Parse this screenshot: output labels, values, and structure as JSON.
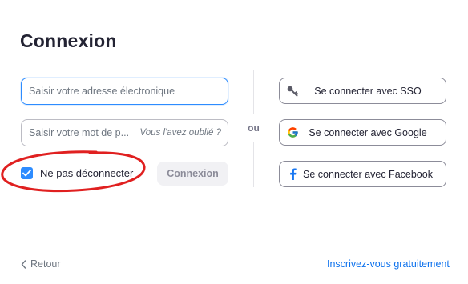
{
  "header": {
    "title": "Connexion"
  },
  "form": {
    "email_placeholder": "Saisir votre adresse électronique",
    "password_placeholder": "Saisir votre mot de p...",
    "forgot_link": "Vous l'avez oublié ?",
    "keep_signed_in_label": "Ne pas déconnecter",
    "keep_signed_in_checked": true,
    "signin_button": "Connexion"
  },
  "divider": {
    "or_label": "ou"
  },
  "social": {
    "sso_label": "Se connecter avec SSO",
    "google_label": "Se connecter avec Google",
    "facebook_label": "Se connecter avec Facebook"
  },
  "footer": {
    "back_label": "Retour",
    "signup_label": "Inscrivez-vous gratuitement"
  },
  "colors": {
    "accent": "#2d8cff",
    "link": "#0e72ed",
    "annotation": "#e02020",
    "facebook": "#1877f2"
  },
  "icons": {
    "sso": "key-icon",
    "google": "google-icon",
    "facebook": "facebook-icon",
    "back": "chevron-left-icon",
    "checkbox": "checkmark-icon"
  }
}
